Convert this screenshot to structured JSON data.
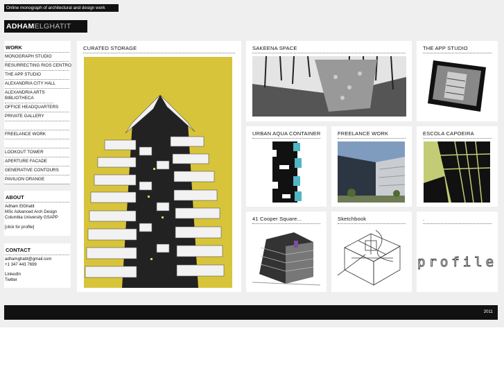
{
  "header": {
    "tagline": "Online monograph of architectural and design work",
    "logo_bold": "ADHAM",
    "logo_light": "ELGHATIT"
  },
  "sidebar": {
    "work_title": "WORK",
    "work_items": [
      "MONOGRAPH STUDIO",
      "RESURRECTING RIOS CENTRO",
      "THE APP STUDIO",
      "ALEXANDRIA CITY HALL",
      "ALEXANDRIA ARTS BIBLIOTHECA",
      "OFFICE HEADQUARTERS",
      "PRIVATE GALLERY",
      "...",
      "FREELANCE WORK",
      "...",
      "LOOKOUT TOWER",
      "APERTURE FACADE",
      "GENERATIVE CONTOURS",
      "PAVILION ORANGE"
    ],
    "about_title": "ABOUT",
    "about_lines": [
      "Adham ElGhatit",
      "MSc Advanced Arch Design",
      "Columbia University GSAPP",
      "",
      "[click for profile]"
    ],
    "contact_title": "CONTACT",
    "contact_lines": [
      "adhamghatit@gmail.com",
      "+1 347 443 7699",
      "",
      "LinkedIn",
      "Twitter"
    ]
  },
  "projects": {
    "curated": "CURATED STORAGE",
    "sakeena": "SAKEENA SPACE",
    "appstudio": "THE APP STUDIO",
    "aqua": "URBAN AQUA CONTAINER",
    "freelance": "FREELANCE WORK",
    "capoeira": "ESCOLA CAPOEIRA",
    "cooper": "41 Cooper Square...",
    "sketchbook": "Sketchbook",
    "profile_title": ".",
    "profile_word": "profile"
  },
  "footer": {
    "year": "2011"
  },
  "colors": {
    "accent_yellow": "#d8c43a",
    "lime": "#c3cc74",
    "teal": "#4fb7c4"
  }
}
